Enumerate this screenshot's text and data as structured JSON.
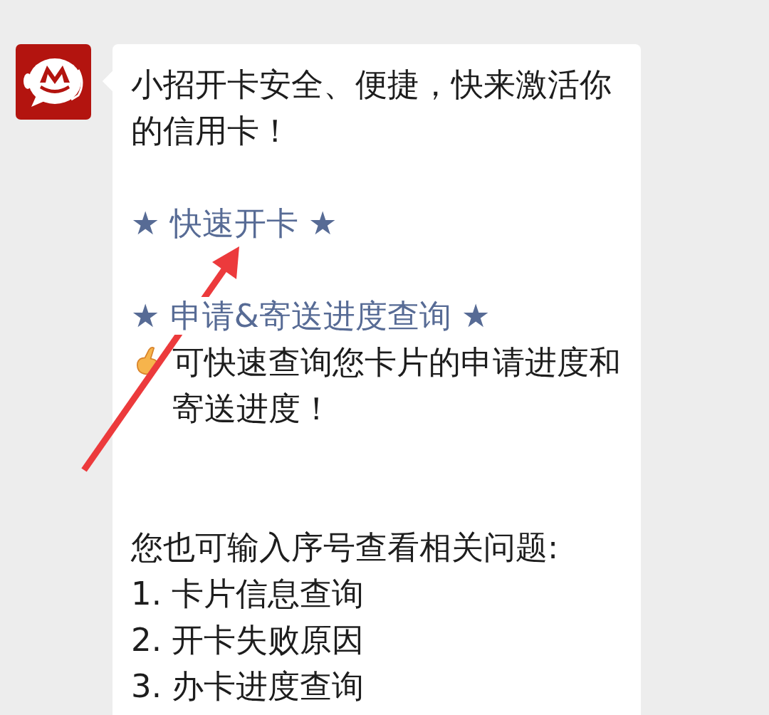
{
  "message": {
    "blocks": [
      {
        "kind": "text",
        "text": "小招开卡安全、便捷，快来激活你的信用卡！"
      },
      {
        "kind": "link",
        "text": "★ 快速开卡 ★"
      },
      {
        "kind": "link",
        "text": "★ 申请&寄送进度查询 ★"
      },
      {
        "kind": "tip",
        "text": "可快速查询您卡片的申请进度和寄送进度！"
      },
      {
        "kind": "prompt",
        "text": "您也可输入序号查看相关问题:"
      },
      {
        "kind": "option",
        "text": "1. 卡片信息查询"
      },
      {
        "kind": "option",
        "text": "2. 开卡失败原因"
      },
      {
        "kind": "option",
        "text": "3. 办卡进度查询"
      }
    ]
  }
}
